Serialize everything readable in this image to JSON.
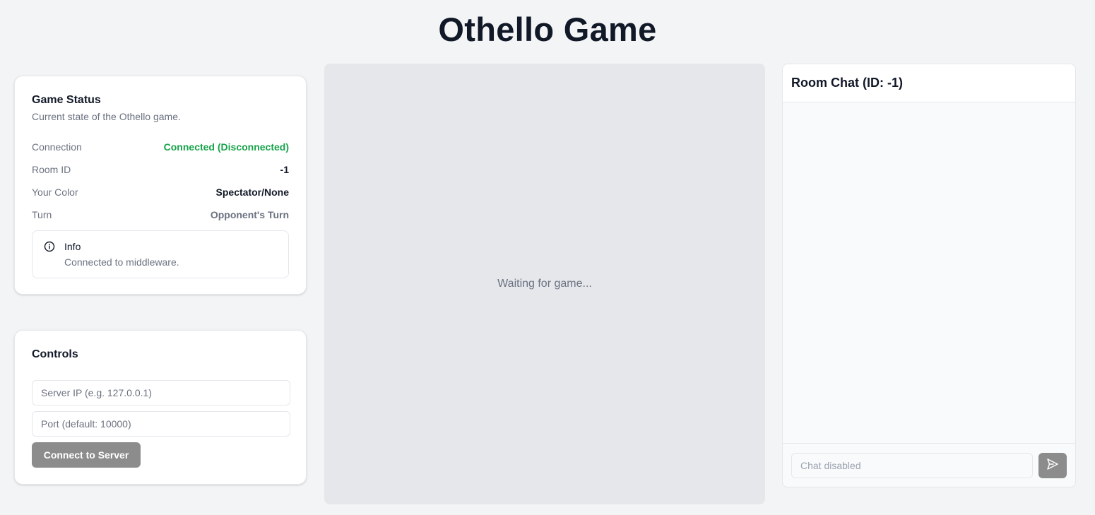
{
  "header": {
    "title": "Othello Game"
  },
  "status": {
    "title": "Game Status",
    "description": "Current state of the Othello game.",
    "rows": [
      {
        "label": "Connection",
        "value": "Connected (Disconnected)"
      },
      {
        "label": "Room ID",
        "value": "-1"
      },
      {
        "label": "Your Color",
        "value": "Spectator/None"
      },
      {
        "label": "Turn",
        "value": "Opponent's Turn"
      }
    ],
    "info": {
      "icon": "info-icon",
      "title": "Info",
      "text": "Connected to middleware."
    }
  },
  "controls": {
    "title": "Controls",
    "server_ip_placeholder": "Server IP (e.g. 127.0.0.1)",
    "port_placeholder": "Port (default: 10000)",
    "connect_label": "Connect to Server"
  },
  "board": {
    "waiting_text": "Waiting for game..."
  },
  "chat": {
    "title": "Room Chat (ID: -1)",
    "input_placeholder": "Chat disabled",
    "send_icon": "send-icon"
  },
  "colors": {
    "background": "#f3f4f6",
    "connected_green": "#16a34a",
    "disabled_button": "#8c8c8c",
    "board_bg": "#e5e7eb"
  }
}
